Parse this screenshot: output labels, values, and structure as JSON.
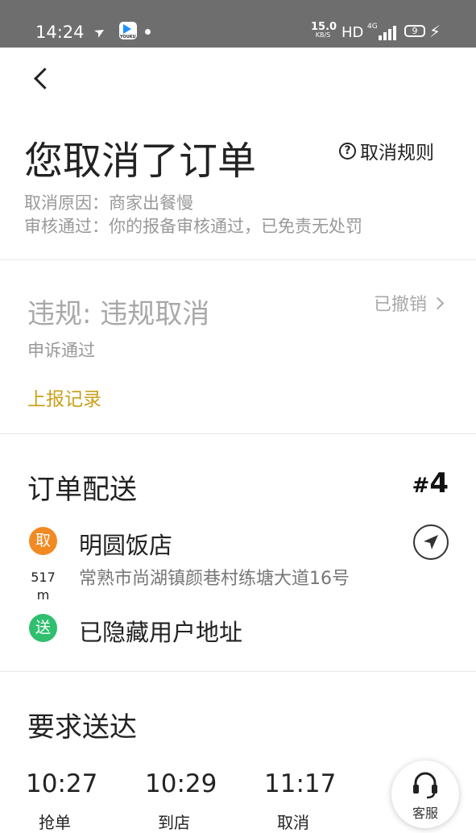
{
  "status_bar": {
    "time": "14:24",
    "app_badge": "YOUKU",
    "net_speed_value": "15.0",
    "net_speed_unit": "KB/S",
    "hd": "HD",
    "network": "4G",
    "battery": "9"
  },
  "header": {
    "title": "您取消了订单",
    "rules_label": "取消规则",
    "reason": "取消原因：商家出餐慢",
    "review": "审核通过：你的报备审核通过，已免责无处罚"
  },
  "violation": {
    "title": "违规: 违规取消",
    "status": "已撤销",
    "appeal": "申诉通过",
    "report_link": "上报记录",
    "report_color": "#c9a21b"
  },
  "delivery": {
    "title": "订单配送",
    "order_hash": "#",
    "order_number": "4",
    "pickup_badge": "取",
    "pickup_color": "#f28a24",
    "shop_name": "明圆饭店",
    "shop_address": "常熟市尚湖镇颜巷村练塘大道16号",
    "distance_value": "517",
    "distance_unit": "m",
    "dropoff_badge": "送",
    "dropoff_color": "#2fbf6f",
    "customer_address": "已隐藏用户地址"
  },
  "required": {
    "title": "要求送达",
    "times": [
      {
        "time": "10:27",
        "label": "抢单"
      },
      {
        "time": "10:29",
        "label": "到店"
      },
      {
        "time": "11:17",
        "label": "取消"
      }
    ]
  },
  "service": {
    "label": "客服"
  }
}
